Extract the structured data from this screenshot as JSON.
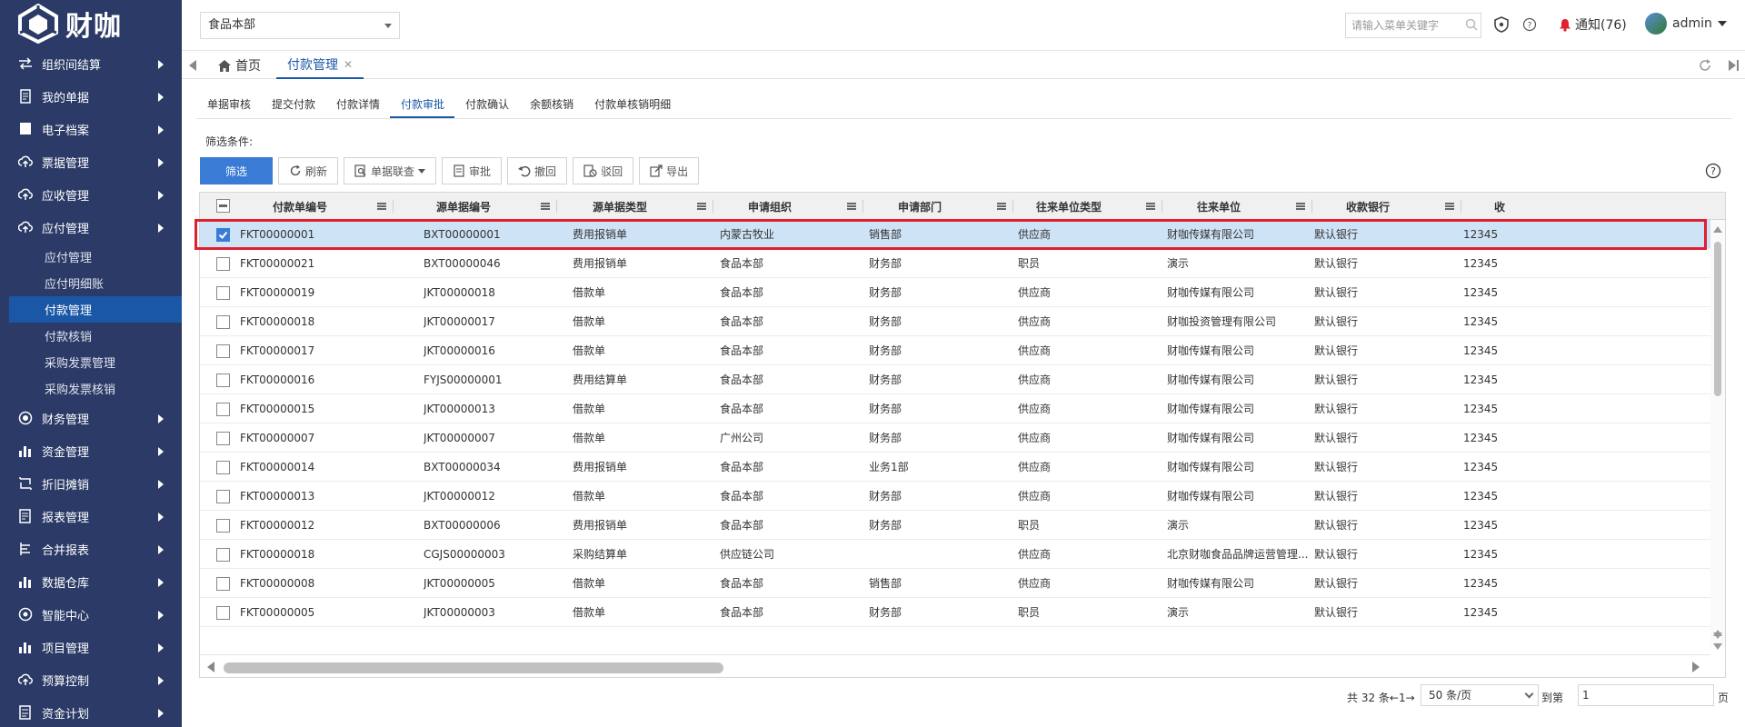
{
  "brand": {
    "name": "财咖"
  },
  "sidebar": {
    "menus": [
      {
        "label": "组织间结算",
        "icon": "transfer-icon"
      },
      {
        "label": "我的单据",
        "icon": "document-icon"
      },
      {
        "label": "电子档案",
        "icon": "archive-icon"
      },
      {
        "label": "票据管理",
        "icon": "cloud-upload-icon"
      },
      {
        "label": "应收管理",
        "icon": "cloud-upload-icon"
      },
      {
        "label": "应付管理",
        "icon": "cloud-upload-icon"
      }
    ],
    "submenus": [
      {
        "label": "应付管理"
      },
      {
        "label": "应付明细账"
      },
      {
        "label": "付款管理"
      },
      {
        "label": "付款核销"
      },
      {
        "label": "采购发票管理"
      },
      {
        "label": "采购发票核销"
      }
    ],
    "menus2": [
      {
        "label": "财务管理",
        "icon": "coin-icon"
      },
      {
        "label": "资金管理",
        "icon": "bar-chart-icon"
      },
      {
        "label": "折旧摊销",
        "icon": "cycle-icon"
      },
      {
        "label": "报表管理",
        "icon": "report-icon"
      },
      {
        "label": "合并报表",
        "icon": "merge-icon"
      },
      {
        "label": "数据仓库",
        "icon": "bar-chart-icon"
      },
      {
        "label": "智能中心",
        "icon": "globe-icon"
      },
      {
        "label": "项目管理",
        "icon": "bar-chart-icon"
      },
      {
        "label": "预算控制",
        "icon": "cloud-upload-icon"
      },
      {
        "label": "资金计划",
        "icon": "database-icon"
      }
    ]
  },
  "header": {
    "org": "食品本部",
    "search_placeholder": "请输入菜单关键字",
    "notify": "通知(76)",
    "user": "admin"
  },
  "tabs": {
    "home": "首页",
    "active": "付款管理"
  },
  "subtabs": [
    "单据审核",
    "提交付款",
    "付款详情",
    "付款审批",
    "付款确认",
    "余额核销",
    "付款单核销明细"
  ],
  "subtab_active_index": 3,
  "filter_label": "筛选条件:",
  "toolbar": {
    "filter": "筛选",
    "refresh": "刷新",
    "linked": "单据联查",
    "approve": "审批",
    "revoke": "撤回",
    "reject": "驳回",
    "export": "导出"
  },
  "columns": [
    "付款单编号",
    "源单据编号",
    "源单据类型",
    "申请组织",
    "申请部门",
    "往来单位类型",
    "往来单位",
    "收款银行",
    "收"
  ],
  "rows": [
    {
      "no": "FKT00000001",
      "src": "BXT00000001",
      "type": "费用报销单",
      "org": "内蒙古牧业",
      "dept": "销售部",
      "ptype": "供应商",
      "partner": "财咖传媒有限公司",
      "bank": "默认银行",
      "acct": "12345€",
      "checked": true
    },
    {
      "no": "FKT00000021",
      "src": "BXT00000046",
      "type": "费用报销单",
      "org": "食品本部",
      "dept": "财务部",
      "ptype": "职员",
      "partner": "演示",
      "bank": "默认银行",
      "acct": "12345€",
      "checked": false
    },
    {
      "no": "FKT00000019",
      "src": "JKT00000018",
      "type": "借款单",
      "org": "食品本部",
      "dept": "财务部",
      "ptype": "供应商",
      "partner": "财咖传媒有限公司",
      "bank": "默认银行",
      "acct": "12345€",
      "checked": false
    },
    {
      "no": "FKT00000018",
      "src": "JKT00000017",
      "type": "借款单",
      "org": "食品本部",
      "dept": "财务部",
      "ptype": "供应商",
      "partner": "财咖投资管理有限公司",
      "bank": "默认银行",
      "acct": "12345€",
      "checked": false
    },
    {
      "no": "FKT00000017",
      "src": "JKT00000016",
      "type": "借款单",
      "org": "食品本部",
      "dept": "财务部",
      "ptype": "供应商",
      "partner": "财咖传媒有限公司",
      "bank": "默认银行",
      "acct": "12345€",
      "checked": false
    },
    {
      "no": "FKT00000016",
      "src": "FYJS00000001",
      "type": "费用结算单",
      "org": "食品本部",
      "dept": "财务部",
      "ptype": "供应商",
      "partner": "财咖传媒有限公司",
      "bank": "默认银行",
      "acct": "12345€",
      "checked": false
    },
    {
      "no": "FKT00000015",
      "src": "JKT00000013",
      "type": "借款单",
      "org": "食品本部",
      "dept": "财务部",
      "ptype": "供应商",
      "partner": "财咖传媒有限公司",
      "bank": "默认银行",
      "acct": "12345€",
      "checked": false
    },
    {
      "no": "FKT00000007",
      "src": "JKT00000007",
      "type": "借款单",
      "org": "广州公司",
      "dept": "财务部",
      "ptype": "供应商",
      "partner": "财咖传媒有限公司",
      "bank": "默认银行",
      "acct": "12345€",
      "checked": false
    },
    {
      "no": "FKT00000014",
      "src": "BXT00000034",
      "type": "费用报销单",
      "org": "食品本部",
      "dept": "业务1部",
      "ptype": "供应商",
      "partner": "财咖传媒有限公司",
      "bank": "默认银行",
      "acct": "12345€",
      "checked": false
    },
    {
      "no": "FKT00000013",
      "src": "JKT00000012",
      "type": "借款单",
      "org": "食品本部",
      "dept": "财务部",
      "ptype": "供应商",
      "partner": "财咖传媒有限公司",
      "bank": "默认银行",
      "acct": "12345€",
      "checked": false
    },
    {
      "no": "FKT00000012",
      "src": "BXT00000006",
      "type": "费用报销单",
      "org": "食品本部",
      "dept": "财务部",
      "ptype": "职员",
      "partner": "演示",
      "bank": "默认银行",
      "acct": "12345€",
      "checked": false
    },
    {
      "no": "FKT00000018",
      "src": "CGJS00000003",
      "type": "采购结算单",
      "org": "供应链公司",
      "dept": "",
      "ptype": "供应商",
      "partner": "北京财咖食品品牌运营管理...",
      "bank": "默认银行",
      "acct": "12345€",
      "checked": false
    },
    {
      "no": "FKT00000008",
      "src": "JKT00000005",
      "type": "借款单",
      "org": "食品本部",
      "dept": "销售部",
      "ptype": "供应商",
      "partner": "财咖传媒有限公司",
      "bank": "默认银行",
      "acct": "12345€",
      "checked": false
    },
    {
      "no": "FKT00000005",
      "src": "JKT00000003",
      "type": "借款单",
      "org": "食品本部",
      "dept": "财务部",
      "ptype": "职员",
      "partner": "演示",
      "bank": "默认银行",
      "acct": "12345€",
      "checked": false
    }
  ],
  "pager": {
    "total": "共 32 条←1→",
    "size": "50 条/页",
    "goto": "到第",
    "page_value": "1",
    "page_suffix": "页"
  },
  "colors": {
    "sidebar": "#2b3a66",
    "accent": "#1b57a7",
    "primary": "#3a7bd5",
    "highlight": "#e0202e",
    "selected_row": "#cfe3f7"
  }
}
